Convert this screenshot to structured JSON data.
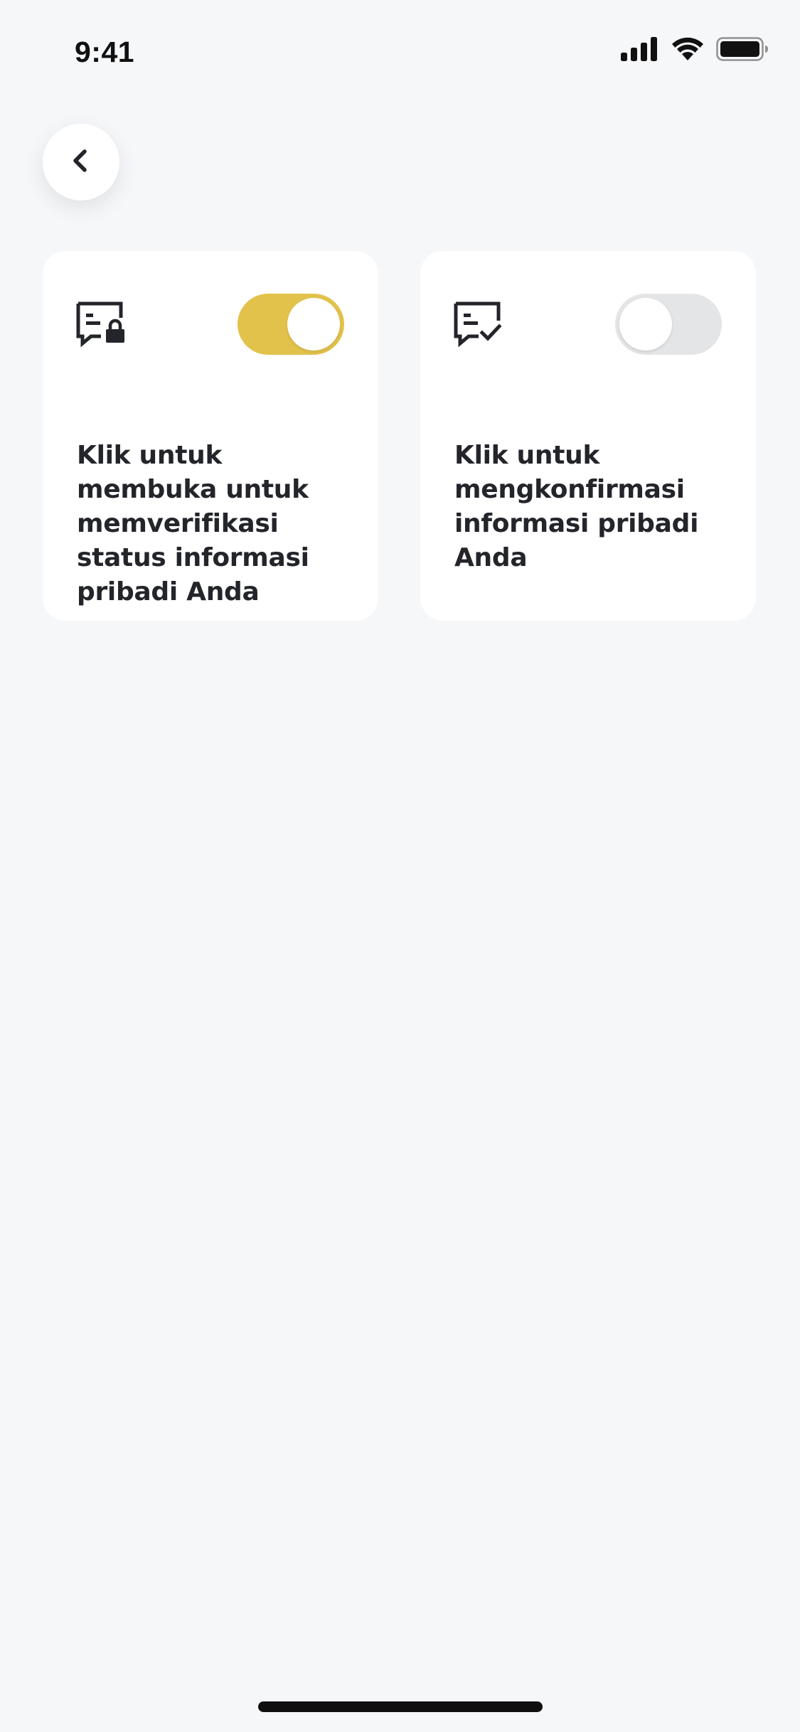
{
  "status_bar": {
    "time": "9:41",
    "icons": [
      "signal-icon",
      "wifi-icon",
      "battery-icon"
    ]
  },
  "header": {
    "back_icon": "chevron-left-icon"
  },
  "cards": [
    {
      "icon": "message-lock-icon",
      "toggle_on": true,
      "text": "Klik untuk membuka untuk memverifikasi status informasi pribadi Anda"
    },
    {
      "icon": "message-check-icon",
      "toggle_on": false,
      "text": "Klik untuk mengkonfirmasi informasi pribadi Anda"
    }
  ],
  "colors": {
    "background": "#F6F7F9",
    "card": "#FFFFFF",
    "toggle_on": "#E2C24B",
    "toggle_off": "#E4E5E7",
    "text": "#23252B"
  }
}
